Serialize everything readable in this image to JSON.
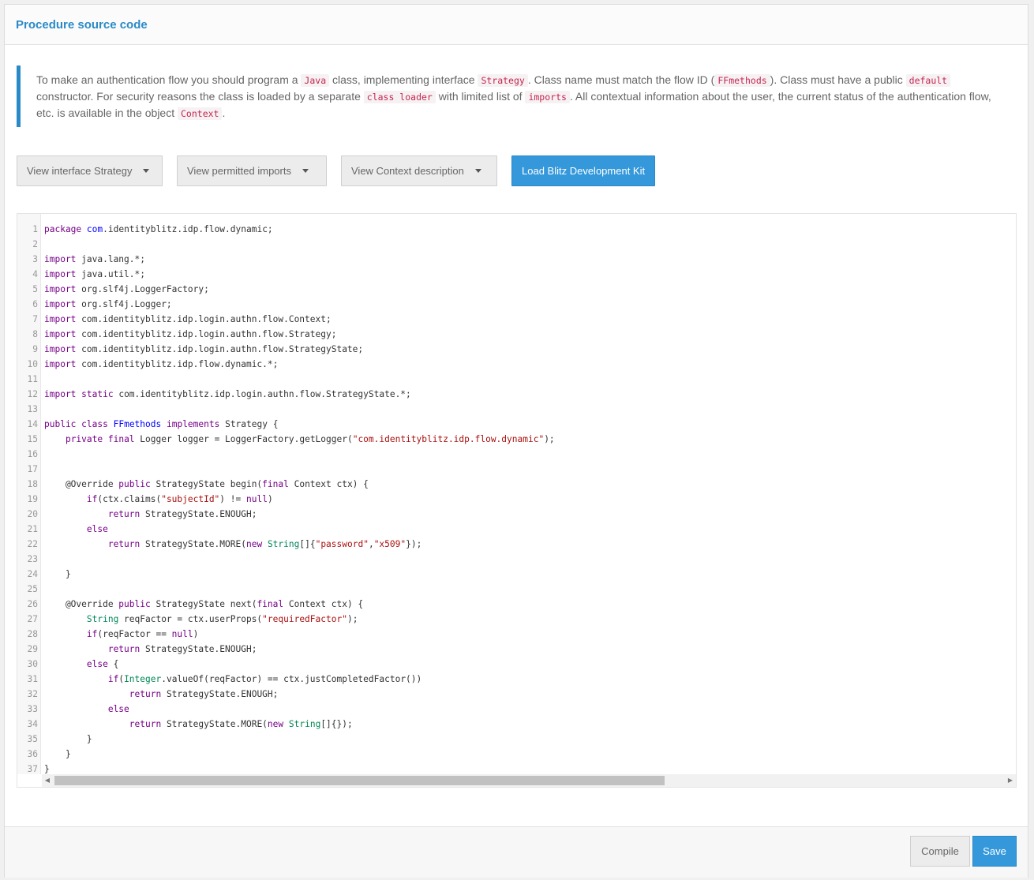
{
  "panel": {
    "title": "Procedure source code"
  },
  "info": {
    "t1": "To make an authentication flow you should program a ",
    "c1": "Java",
    "t2": " class, implementing interface ",
    "c2": "Strategy",
    "t3": ". Class name must match the flow ID (",
    "c3": "FFmethods",
    "t4": "). Class must have a public ",
    "c4": "default",
    "t5": " constructor. For security reasons the class is loaded by a separate ",
    "c5": "class loader",
    "t6": " with limited list of ",
    "c6": "imports",
    "t7": ". All contextual information about the user, the current status of the authentication flow, etc. is available in the object ",
    "c7": "Context",
    "t8": "."
  },
  "toolbar": {
    "view_interface": "View interface Strategy",
    "view_imports": "View permitted imports",
    "view_context": "View Context description",
    "load_kit": "Load Blitz Development Kit"
  },
  "code_lines": [
    [
      [
        "kw",
        "package"
      ],
      [
        "p",
        " "
      ],
      [
        "def",
        "com"
      ],
      [
        "p",
        ".identityblitz.idp.flow.dynamic;"
      ]
    ],
    [],
    [
      [
        "kw",
        "import"
      ],
      [
        "p",
        " java.lang.*;"
      ]
    ],
    [
      [
        "kw",
        "import"
      ],
      [
        "p",
        " java.util.*;"
      ]
    ],
    [
      [
        "kw",
        "import"
      ],
      [
        "p",
        " org.slf4j.LoggerFactory;"
      ]
    ],
    [
      [
        "kw",
        "import"
      ],
      [
        "p",
        " org.slf4j.Logger;"
      ]
    ],
    [
      [
        "kw",
        "import"
      ],
      [
        "p",
        " com.identityblitz.idp.login.authn.flow.Context;"
      ]
    ],
    [
      [
        "kw",
        "import"
      ],
      [
        "p",
        " com.identityblitz.idp.login.authn.flow.Strategy;"
      ]
    ],
    [
      [
        "kw",
        "import"
      ],
      [
        "p",
        " com.identityblitz.idp.login.authn.flow.StrategyState;"
      ]
    ],
    [
      [
        "kw",
        "import"
      ],
      [
        "p",
        " com.identityblitz.idp.flow.dynamic.*;"
      ]
    ],
    [],
    [
      [
        "kw",
        "import"
      ],
      [
        "p",
        " "
      ],
      [
        "kw",
        "static"
      ],
      [
        "p",
        " com.identityblitz.idp.login.authn.flow.StrategyState.*;"
      ]
    ],
    [],
    [
      [
        "kw",
        "public"
      ],
      [
        "p",
        " "
      ],
      [
        "kw",
        "class"
      ],
      [
        "p",
        " "
      ],
      [
        "def",
        "FFmethods"
      ],
      [
        "p",
        " "
      ],
      [
        "kw",
        "implements"
      ],
      [
        "p",
        " Strategy {"
      ]
    ],
    [
      [
        "p",
        "    "
      ],
      [
        "kw",
        "private"
      ],
      [
        "p",
        " "
      ],
      [
        "kw",
        "final"
      ],
      [
        "p",
        " Logger logger = LoggerFactory.getLogger("
      ],
      [
        "str",
        "\"com.identityblitz.idp.flow.dynamic\""
      ],
      [
        "p",
        ");"
      ]
    ],
    [],
    [],
    [
      [
        "p",
        "    @Override "
      ],
      [
        "kw",
        "public"
      ],
      [
        "p",
        " StrategyState begin("
      ],
      [
        "kw",
        "final"
      ],
      [
        "p",
        " Context ctx) {"
      ]
    ],
    [
      [
        "p",
        "        "
      ],
      [
        "kw",
        "if"
      ],
      [
        "p",
        "(ctx.claims("
      ],
      [
        "str",
        "\"subjectId\""
      ],
      [
        "p",
        ") != "
      ],
      [
        "kw",
        "null"
      ],
      [
        "p",
        ")"
      ]
    ],
    [
      [
        "p",
        "            "
      ],
      [
        "kw",
        "return"
      ],
      [
        "p",
        " StrategyState.ENOUGH;"
      ]
    ],
    [
      [
        "p",
        "        "
      ],
      [
        "kw",
        "else"
      ]
    ],
    [
      [
        "p",
        "            "
      ],
      [
        "kw",
        "return"
      ],
      [
        "p",
        " StrategyState.MORE("
      ],
      [
        "kw",
        "new"
      ],
      [
        "p",
        " "
      ],
      [
        "typ",
        "String"
      ],
      [
        "p",
        "[]{"
      ],
      [
        "str",
        "\"password\""
      ],
      [
        "p",
        ","
      ],
      [
        "str",
        "\"x509\""
      ],
      [
        "p",
        "});"
      ]
    ],
    [],
    [
      [
        "p",
        "    }"
      ]
    ],
    [],
    [
      [
        "p",
        "    @Override "
      ],
      [
        "kw",
        "public"
      ],
      [
        "p",
        " StrategyState next("
      ],
      [
        "kw",
        "final"
      ],
      [
        "p",
        " Context ctx) {"
      ]
    ],
    [
      [
        "p",
        "        "
      ],
      [
        "typ",
        "String"
      ],
      [
        "p",
        " reqFactor = ctx.userProps("
      ],
      [
        "str",
        "\"requiredFactor\""
      ],
      [
        "p",
        ");"
      ]
    ],
    [
      [
        "p",
        "        "
      ],
      [
        "kw",
        "if"
      ],
      [
        "p",
        "(reqFactor == "
      ],
      [
        "kw",
        "null"
      ],
      [
        "p",
        ")"
      ]
    ],
    [
      [
        "p",
        "            "
      ],
      [
        "kw",
        "return"
      ],
      [
        "p",
        " StrategyState.ENOUGH;"
      ]
    ],
    [
      [
        "p",
        "        "
      ],
      [
        "kw",
        "else"
      ],
      [
        "p",
        " {"
      ]
    ],
    [
      [
        "p",
        "            "
      ],
      [
        "kw",
        "if"
      ],
      [
        "p",
        "("
      ],
      [
        "typ",
        "Integer"
      ],
      [
        "p",
        ".valueOf(reqFactor) == ctx.justCompletedFactor())"
      ]
    ],
    [
      [
        "p",
        "                "
      ],
      [
        "kw",
        "return"
      ],
      [
        "p",
        " StrategyState.ENOUGH;"
      ]
    ],
    [
      [
        "p",
        "            "
      ],
      [
        "kw",
        "else"
      ]
    ],
    [
      [
        "p",
        "                "
      ],
      [
        "kw",
        "return"
      ],
      [
        "p",
        " StrategyState.MORE("
      ],
      [
        "kw",
        "new"
      ],
      [
        "p",
        " "
      ],
      [
        "typ",
        "String"
      ],
      [
        "p",
        "[]{});"
      ]
    ],
    [
      [
        "p",
        "        }"
      ]
    ],
    [
      [
        "p",
        "    }"
      ]
    ],
    [
      [
        "p",
        "}"
      ]
    ]
  ],
  "scrollbar": {
    "left_arrow": "◀",
    "right_arrow": "▶"
  },
  "footer": {
    "compile": "Compile",
    "save": "Save"
  }
}
